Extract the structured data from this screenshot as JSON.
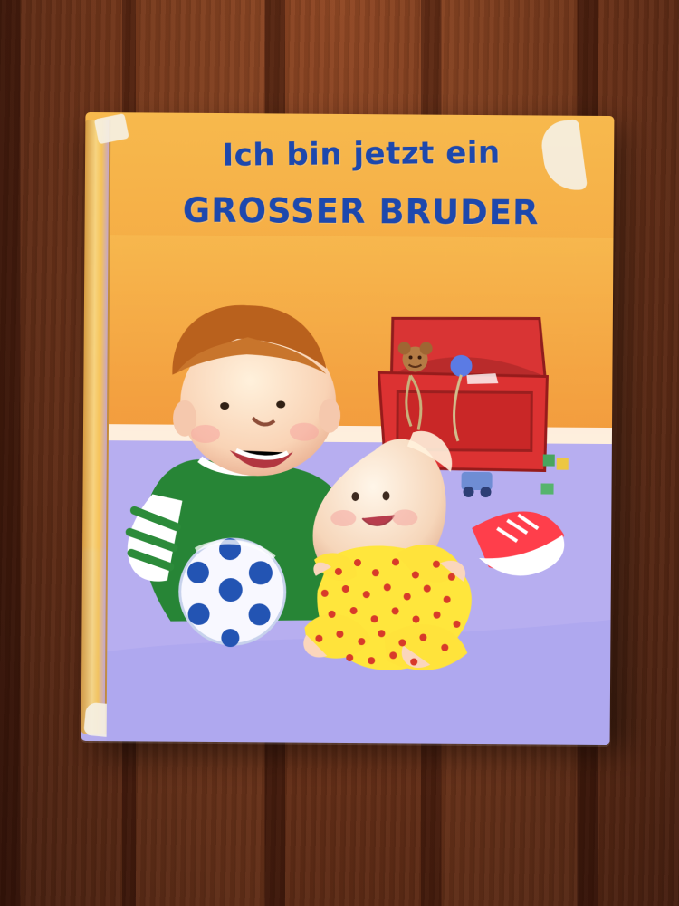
{
  "book": {
    "title_line_1": "Ich bin jetzt ein",
    "title_line_2": "GROSSER BRUDER"
  },
  "colors": {
    "title": "#1d48ad",
    "cover_orange": "#f3a13e",
    "floor_purple": "#b4acec",
    "toy_box_red": "#d82e2e",
    "shirt_green": "#31863c",
    "onesie_yellow": "#ffe53b",
    "polka_dots": "#d83a2a"
  },
  "icons": [
    "ball-icon",
    "teddy-bear-icon",
    "toy-box-icon"
  ]
}
